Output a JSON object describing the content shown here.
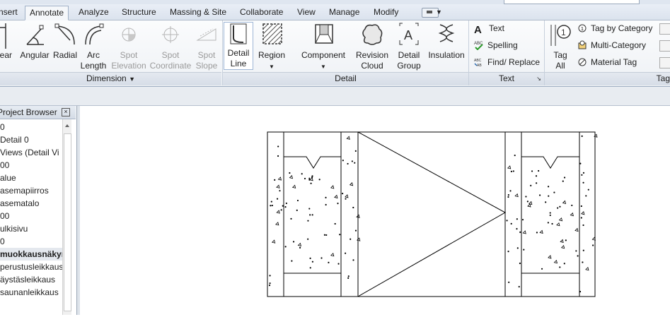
{
  "tabs": [
    {
      "label": "nsert",
      "active": false
    },
    {
      "label": "Annotate",
      "active": true
    },
    {
      "label": "Analyze",
      "active": false
    },
    {
      "label": "Structure",
      "active": false
    },
    {
      "label": "Massing & Site",
      "active": false
    },
    {
      "label": "Collaborate",
      "active": false
    },
    {
      "label": "View",
      "active": false
    },
    {
      "label": "Manage",
      "active": false
    },
    {
      "label": "Modify",
      "active": false
    }
  ],
  "ribbon": {
    "dimension": {
      "panel_label": "Dimension",
      "linear": "near",
      "angular": "Angular",
      "radial": "Radial",
      "arc_length_1": "Arc",
      "arc_length_2": "Length",
      "spot_elevation_1": "Spot",
      "spot_elevation_2": "Elevation",
      "spot_coordinate_1": "Spot",
      "spot_coordinate_2": "Coordinate",
      "spot_slope_1": "Spot",
      "spot_slope_2": "Slope"
    },
    "detail": {
      "panel_label": "Detail",
      "detail_line_1": "Detail",
      "detail_line_2": "Line",
      "region": "Region",
      "component": "Component",
      "revision_cloud_1": "Revision",
      "revision_cloud_2": "Cloud",
      "detail_group_1": "Detail",
      "detail_group_2": "Group",
      "insulation": "Insulation"
    },
    "text": {
      "panel_label": "Text",
      "text": "Text",
      "spelling": "Spelling",
      "find_replace": "Find/ Replace"
    },
    "tag": {
      "panel_label": "Tag",
      "tag_all_1": "Tag",
      "tag_all_2": "All",
      "tag_by_category": "Tag by Category",
      "multi_category": "Multi-Category",
      "material_tag": "Material Tag"
    }
  },
  "browser": {
    "title": "Project Browser",
    "items": [
      {
        "label": "0",
        "selected": false
      },
      {
        "label": "Detail 0",
        "selected": false
      },
      {
        "label": " Views (Detail Vi",
        "selected": false
      },
      {
        "label": "00",
        "selected": false
      },
      {
        "label": "alue",
        "selected": false
      },
      {
        "label": "asemapiirros",
        "selected": false
      },
      {
        "label": "asematalo",
        "selected": false
      },
      {
        "label": "00",
        "selected": false
      },
      {
        "label": "ulkisivu",
        "selected": false
      },
      {
        "label": "0",
        "selected": false
      },
      {
        "label": "muokkausnäkym",
        "selected": true
      },
      {
        "label": "perustusleikkaus",
        "selected": false
      },
      {
        "label": "äystäsleikkaus",
        "selected": false
      },
      {
        "label": "saunanleikkaus",
        "selected": false
      }
    ]
  },
  "colors": {
    "accent": "#3a6fb0",
    "ribbon_bg": "#eef1f5",
    "panel_bar": "#d6dde7"
  }
}
